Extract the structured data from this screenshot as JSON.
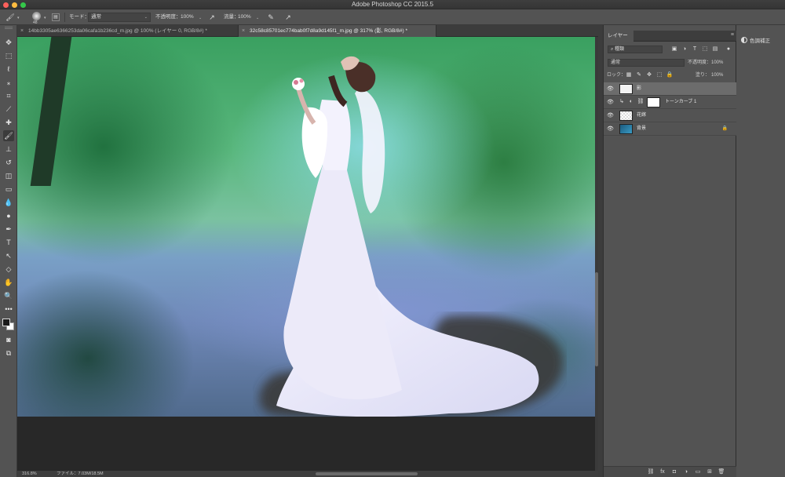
{
  "window": {
    "title": "Adobe Photoshop CC 2015.5"
  },
  "options_bar": {
    "brush_size": "48",
    "mode_label": "モード：",
    "mode_value": "通常",
    "opacity_label": "不透明度：",
    "opacity_value": "100%",
    "flow_label": "流量：",
    "flow_value": "100%"
  },
  "tabs": [
    {
      "label": "14bb3305ae6366253da06cafa1b236cd_m.jpg @ 100% (レイヤー 0, RGB/8#) *",
      "active": false
    },
    {
      "label": "32c58c85701ec774bab0f7d8a9d145f1_m.jpg @ 317% (影, RGB/8#) *",
      "active": true
    }
  ],
  "status_bar": {
    "zoom": "316.8%",
    "doc_info": "ファイル：7.03M/18.5M"
  },
  "layers_panel": {
    "tab_label": "レイヤー",
    "filter_value": "種類",
    "blend_mode": "通常",
    "opacity_label": "不透明度：",
    "opacity_value": "100%",
    "lock_label": "ロック：",
    "fill_label": "塗り：",
    "fill_value": "100%",
    "layers": [
      {
        "name": "影",
        "selected": true,
        "thumb_color": "#f2f2f2",
        "visible": true,
        "locked": false
      },
      {
        "name": "トーンカーブ 1",
        "selected": false,
        "thumb_color": "#ffffff",
        "visible": true,
        "locked": false
      },
      {
        "name": "花嫁",
        "selected": false,
        "thumb_color": "#e6e6e6",
        "visible": true,
        "locked": false
      },
      {
        "name": "背景",
        "selected": false,
        "thumb_color": "#2a7aa8",
        "visible": true,
        "locked": true
      }
    ]
  },
  "adjustments_panel": {
    "item_label": "色調補正"
  },
  "colors": {
    "foreground": "#1a1a1a",
    "background": "#ffffff",
    "selected_layer": "#6c6c6c"
  }
}
